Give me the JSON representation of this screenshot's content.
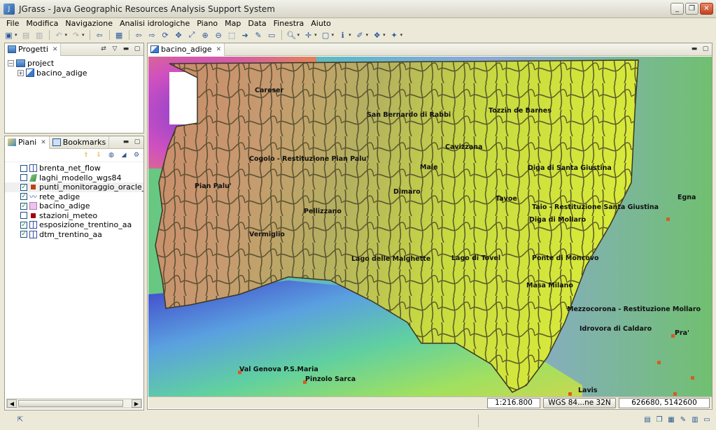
{
  "window": {
    "title": "JGrass - Java Geographic Resources Analysis Support System"
  },
  "menu": [
    "File",
    "Modifica",
    "Navigazione",
    "Analisi idrologiche",
    "Piano",
    "Map",
    "Data",
    "Finestra",
    "Aiuto"
  ],
  "projects_panel": {
    "tab_label": "Progetti",
    "tree": {
      "root": "project",
      "child": "bacino_adige"
    }
  },
  "layers_panel": {
    "tabs": [
      "Piani",
      "Bookmarks"
    ],
    "layers": [
      {
        "name": "brenta_net_flow",
        "checked": false,
        "icon": "grid-icon"
      },
      {
        "name": "laghi_modello_wgs84",
        "checked": false,
        "icon": "polygon-icon"
      },
      {
        "name": "punti_monitoraggio_oracle_final_utm_c",
        "checked": true,
        "icon": "point-icon"
      },
      {
        "name": "rete_adige",
        "checked": true,
        "icon": "line-icon"
      },
      {
        "name": "bacino_adige",
        "checked": true,
        "icon": "polygon-pink-icon"
      },
      {
        "name": "stazioni_meteo",
        "checked": false,
        "icon": "point-red-icon"
      },
      {
        "name": "esposizione_trentino_aa",
        "checked": true,
        "icon": "grid-icon"
      },
      {
        "name": "dtm_trentino_aa",
        "checked": true,
        "icon": "grid-icon"
      }
    ]
  },
  "map_editor": {
    "tab_label": "bacino_adige",
    "places": [
      "Careser",
      "San Bernardo di Rabbi",
      "Tozzin de Barnes",
      "Cavizzana",
      "Cogolo - Restituzione Pian Palu'",
      "Male",
      "Diga di Santa Giustina",
      "Pian Palu'",
      "Dimaro",
      "Tavoe",
      "Taio - Restituzione Santa Giustina",
      "Egna",
      "Pellizzano",
      "Diga di Mollaro",
      "Vermiglio",
      "Lago delle Malghette",
      "Lago di Tovel",
      "Ponte di Moncovo",
      "Masa Milano",
      "Mezzocorona - Restituzione Mollaro",
      "Idrovora di Caldaro",
      "Pra'",
      "Val Genova P.S.Maria",
      "Pinzolo Sarca",
      "Lavis"
    ],
    "status": {
      "scale": "1:216.800",
      "crs": "WGS 84...ne 32N",
      "coordinates": "626680, 5142600"
    }
  }
}
